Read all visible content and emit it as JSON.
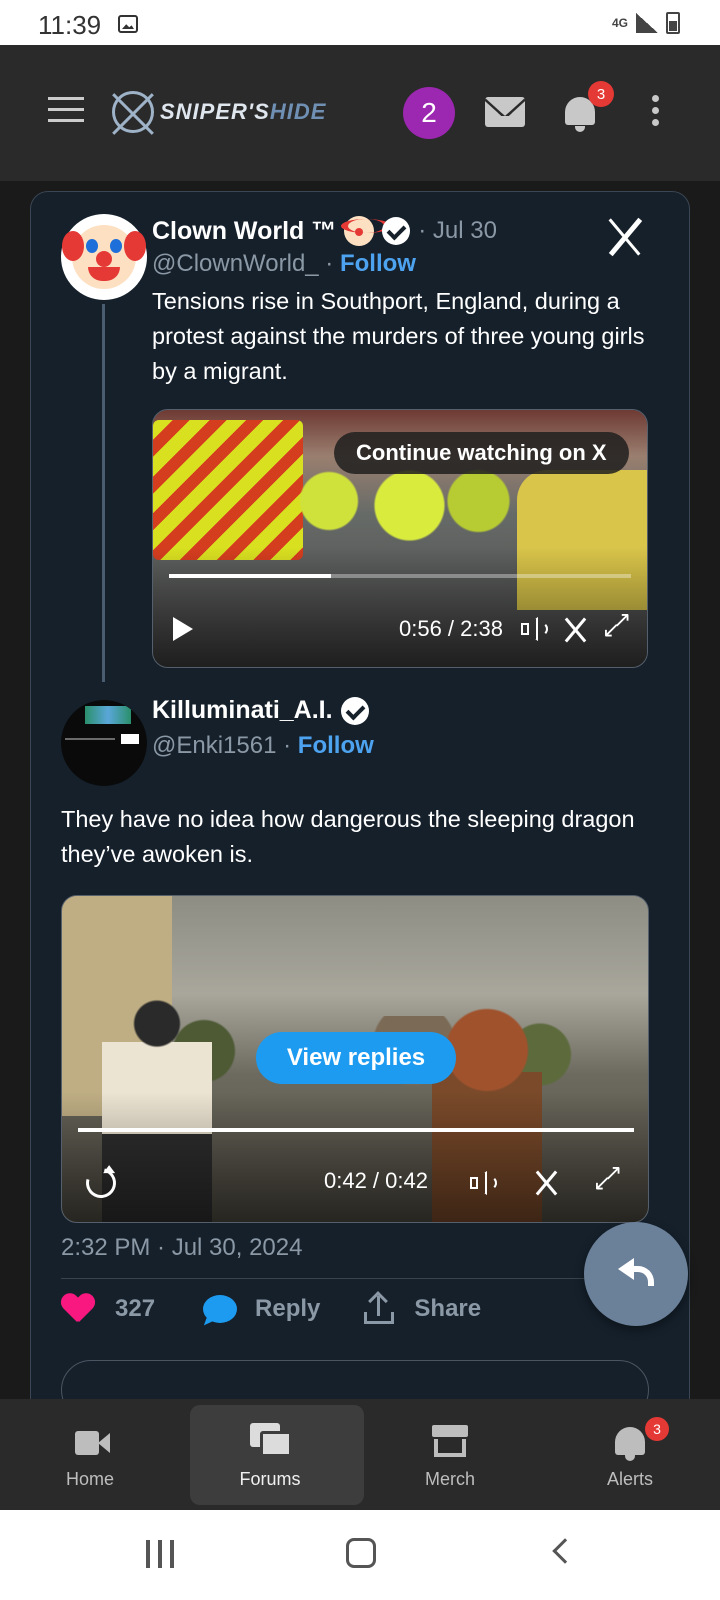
{
  "status_bar": {
    "time": "11:39"
  },
  "header": {
    "logo_text_a": "SNIPER'S",
    "logo_text_b": "HIDE",
    "user_avatar_initial": "2",
    "alerts_badge": "3"
  },
  "tweet1": {
    "name": "Clown World ™",
    "date": "· Jul 30",
    "handle": "@ClownWorld_",
    "follow_sep": " · ",
    "follow": "Follow",
    "text": "Tensions rise in Southport, England, during a protest against the murders of three young girls by a migrant.",
    "video": {
      "overlay": "Continue watching on X",
      "time": "0:56 / 2:38",
      "progress": 0.35
    }
  },
  "tweet2": {
    "name": "Killuminati_A.I.",
    "handle": "@Enki1561",
    "follow_sep": " · ",
    "follow": "Follow",
    "text": "They have no idea how dangerous the sleeping dragon they’ve awoken is.",
    "video": {
      "overlay": "View replies",
      "time": "0:42 / 0:42",
      "progress": 1.0
    },
    "timestamp": "2:32 PM · Jul 30, 2024",
    "likes": "327",
    "reply_label": "Reply",
    "share_label": "Share"
  },
  "bottom_nav": {
    "items": [
      {
        "label": "Home",
        "icon": "video-camera-icon"
      },
      {
        "label": "Forums",
        "icon": "forums-icon"
      },
      {
        "label": "Merch",
        "icon": "store-icon"
      },
      {
        "label": "Alerts",
        "icon": "bell-icon"
      }
    ],
    "alerts_badge": "3",
    "active": "Forums"
  },
  "colors": {
    "accent_blue": "#1d9bf0",
    "like_pink": "#f91880",
    "avatar_purple": "#9c27b0",
    "badge_red": "#e53935"
  }
}
